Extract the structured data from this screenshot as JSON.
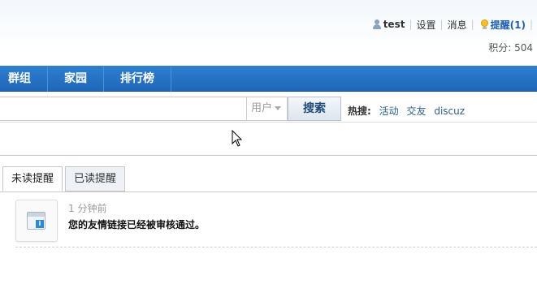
{
  "user_bar": {
    "username": "test",
    "settings": "设置",
    "messages": "消息",
    "reminders": "提醒(1)",
    "user_icon": "user-icon",
    "bulb_icon": "bulb-icon"
  },
  "credits": "积分: 504",
  "nav": {
    "items": [
      {
        "label": "群组"
      },
      {
        "label": "家园"
      },
      {
        "label": "排行榜"
      }
    ]
  },
  "search": {
    "query": "",
    "type": "用户",
    "button": "搜索",
    "hot_label": "热搜:",
    "hot_terms": [
      "活动",
      "交友",
      "discuz"
    ]
  },
  "tabs": [
    {
      "label": "未读提醒",
      "active": true
    },
    {
      "label": "已读提醒",
      "active": false
    }
  ],
  "notice": {
    "time": "1 分钟前",
    "text": "您的友情链接已经被审核通过。",
    "icon": "window-info-icon"
  },
  "colors": {
    "nav_bg": "#2e7fd1",
    "link": "#2a5e92",
    "reminder": "#1c5fb4"
  }
}
